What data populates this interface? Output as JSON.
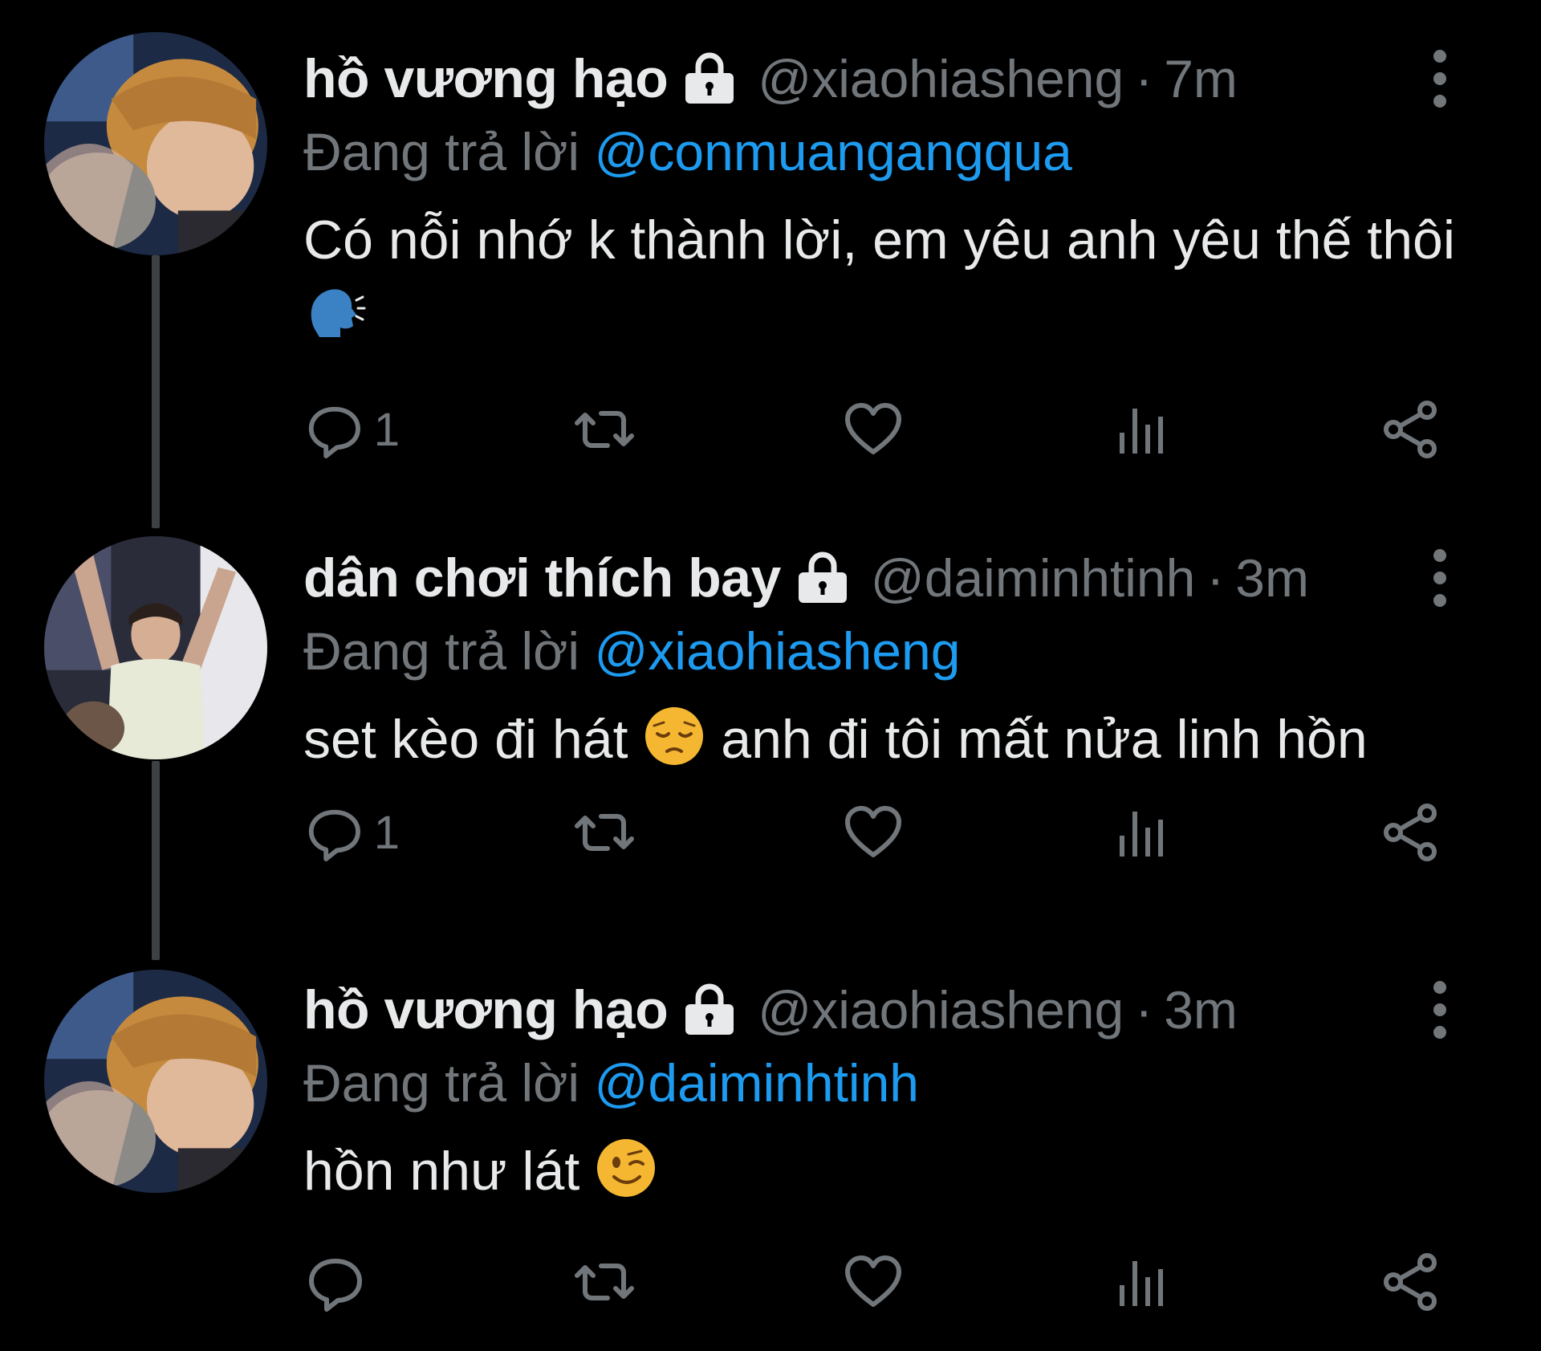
{
  "reply_prefix": "Đang trả lời",
  "colors": {
    "background": "#000000",
    "text": "#e7e9ea",
    "muted": "#71767b",
    "mention": "#1d9bf0",
    "thread_line": "#3e4144"
  },
  "tweets": [
    {
      "name": "hồ vương hạo",
      "handle": "@xiaohiasheng",
      "separator": "·",
      "time": "7m",
      "reply_to": "@conmuangangqua",
      "text": "Có nỗi nhớ k thành lời, em yêu anh yêu thế thôi",
      "emoji": "speaking-head-emoji",
      "reply_count": "1",
      "icons": [
        "reply-icon",
        "retweet-icon",
        "like-icon",
        "views-icon",
        "share-icon"
      ]
    },
    {
      "name": "dân chơi thích bay",
      "handle": "@daiminhtinh",
      "separator": "·",
      "time": "3m",
      "reply_to": "@xiaohiasheng",
      "text_before": "set kèo đi hát",
      "emoji": "pensive-face-emoji",
      "text_after": "anh đi tôi mất nửa linh hồn",
      "reply_count": "1"
    },
    {
      "name": "hồ vương hạo",
      "handle": "@xiaohiasheng",
      "separator": "·",
      "time": "3m",
      "reply_to": "@daiminhtinh",
      "text": "hồn như lát",
      "emoji": "winking-face-emoji",
      "reply_count": ""
    }
  ]
}
